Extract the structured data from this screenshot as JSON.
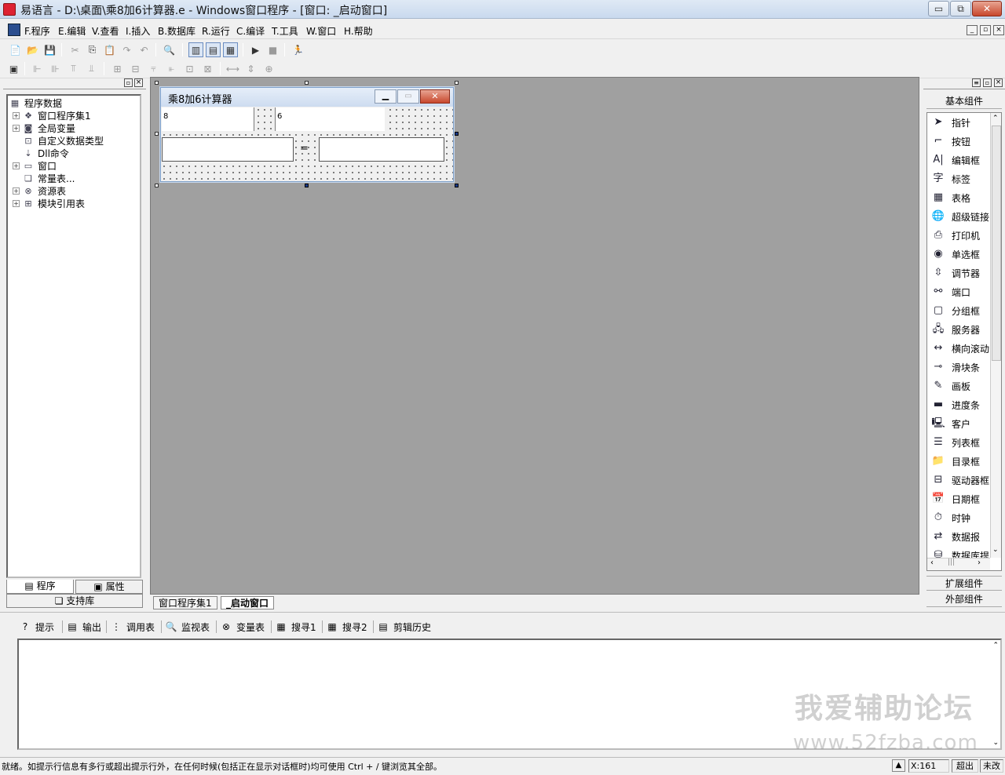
{
  "window": {
    "title": "易语言 - D:\\桌面\\乘8加6计算器.e - Windows窗口程序 - [窗口: _启动窗口]",
    "min_glyph": "▭",
    "max_glyph": "⧉",
    "close_glyph": "✕"
  },
  "menu": {
    "items": [
      "F.程序",
      "E.编辑",
      "V.查看",
      "I.插入",
      "B.数据库",
      "R.运行",
      "C.编译",
      "T.工具",
      "W.窗口",
      "H.帮助"
    ],
    "mdi": [
      "_",
      "▫",
      "×"
    ]
  },
  "toolbar1": {
    "icons": [
      "📄",
      "📂",
      "💾",
      "✂",
      "⎘",
      "📋",
      "↷",
      "↶",
      "🔍",
      "▥",
      "▤",
      "▦",
      "▶",
      "■",
      "🏃"
    ]
  },
  "toolbar2": {
    "icons": [
      "▣",
      "⊩",
      "⊪",
      "⫪",
      "⫫",
      "⊞",
      "⊟",
      "⫧",
      "⫦",
      "⊡",
      "⊠",
      "⟷",
      "⇕",
      "⊕"
    ]
  },
  "left_panel": {
    "pin": "▫",
    "close": "×",
    "root": "程序数据",
    "items": [
      {
        "label": "窗口程序集1",
        "expand": "+",
        "icon": "❖"
      },
      {
        "label": "全局变量",
        "expand": "+",
        "icon": "◙"
      },
      {
        "label": "自定义数据类型",
        "expand": "",
        "icon": "⊡"
      },
      {
        "label": "Dll命令",
        "expand": "",
        "icon": "⇣"
      },
      {
        "label": "窗口",
        "expand": "+",
        "icon": "▭"
      },
      {
        "label": "常量表...",
        "expand": "",
        "icon": "❏"
      },
      {
        "label": "资源表",
        "expand": "+",
        "icon": "⊗"
      },
      {
        "label": "模块引用表",
        "expand": "+",
        "icon": "⊞"
      }
    ],
    "tab_program": "程序",
    "tab_props": "属性",
    "tab_support": "支持库"
  },
  "form": {
    "title": "乘8加6计算器",
    "edit1": "8",
    "edit2": "6",
    "equals": "=",
    "result": ""
  },
  "right_panel": {
    "header": "基本组件",
    "components": [
      {
        "name": "指针",
        "icon": "➤"
      },
      {
        "name": "按钮",
        "icon": "⌐"
      },
      {
        "name": "编辑框",
        "icon": "A|"
      },
      {
        "name": "标签",
        "icon": "字"
      },
      {
        "name": "表格",
        "icon": "▦"
      },
      {
        "name": "超级链接",
        "icon": "🌐"
      },
      {
        "name": "打印机",
        "icon": "⎙"
      },
      {
        "name": "单选框",
        "icon": "◉"
      },
      {
        "name": "调节器",
        "icon": "⇳"
      },
      {
        "name": "端口",
        "icon": "⚯"
      },
      {
        "name": "分组框",
        "icon": "▢"
      },
      {
        "name": "服务器",
        "icon": "🖧"
      },
      {
        "name": "横向滚动",
        "icon": "↔"
      },
      {
        "name": "滑块条",
        "icon": "⊸"
      },
      {
        "name": "画板",
        "icon": "✎"
      },
      {
        "name": "进度条",
        "icon": "▬"
      },
      {
        "name": "客户",
        "icon": "🖳"
      },
      {
        "name": "列表框",
        "icon": "☰"
      },
      {
        "name": "目录框",
        "icon": "📁"
      },
      {
        "name": "驱动器框",
        "icon": "⊟"
      },
      {
        "name": "日期框",
        "icon": "📅"
      },
      {
        "name": "时钟",
        "icon": "⏱"
      },
      {
        "name": "数据报",
        "icon": "⇄"
      },
      {
        "name": "数据库提",
        "icon": "⛁"
      }
    ],
    "ext": "扩展组件",
    "outer": "外部组件"
  },
  "editor_tabs": [
    "窗口程序集1",
    "_启动窗口"
  ],
  "output_tabs": [
    {
      "label": "提示",
      "icon": "?"
    },
    {
      "label": "输出",
      "icon": "▤"
    },
    {
      "label": "调用表",
      "icon": "⋮"
    },
    {
      "label": "监视表",
      "icon": "🔍"
    },
    {
      "label": "变量表",
      "icon": "⊗"
    },
    {
      "label": "搜寻1",
      "icon": "▦"
    },
    {
      "label": "搜寻2",
      "icon": "▦"
    },
    {
      "label": "剪辑历史",
      "icon": "▤"
    }
  ],
  "watermark": {
    "line1": "我爱辅助论坛",
    "line2": "www.52fzba.com"
  },
  "status": {
    "message": "就绪。如提示行信息有多行或超出提示行外，在任何时候(包括正在显示对话框时)均可使用 Ctrl + / 键浏览其全部。",
    "coord": "X:161",
    "mode": "超出",
    "modified": "未改"
  }
}
